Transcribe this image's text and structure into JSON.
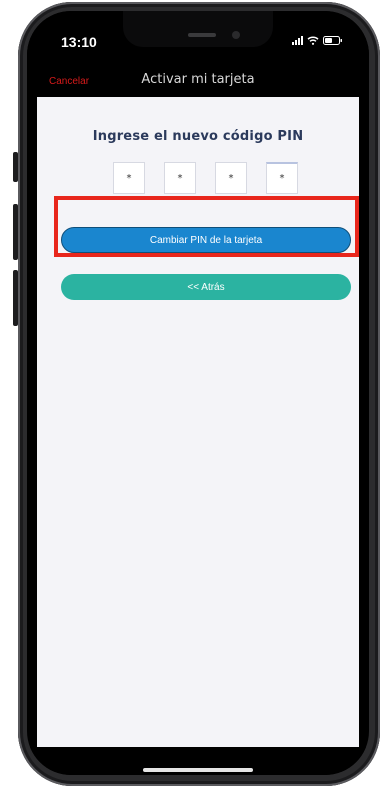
{
  "status_bar": {
    "time": "13:10",
    "icons": [
      "signal-icon",
      "wifi-icon",
      "battery-icon"
    ]
  },
  "nav": {
    "cancel_label": "Cancelar",
    "title": "Activar mi tarjeta"
  },
  "pin_form": {
    "heading": "Ingrese el nuevo código PIN",
    "digits": [
      "*",
      "*",
      "*",
      "*"
    ]
  },
  "buttons": {
    "change_pin_label": "Cambiar PIN de la tarjeta",
    "back_label": "<< Atrás"
  },
  "colors": {
    "cancel": "#d71a1a",
    "primary_button": "#1a86cf",
    "back_button": "#2bb3a1",
    "heading": "#2b3a5c",
    "highlight": "#e8261c"
  }
}
